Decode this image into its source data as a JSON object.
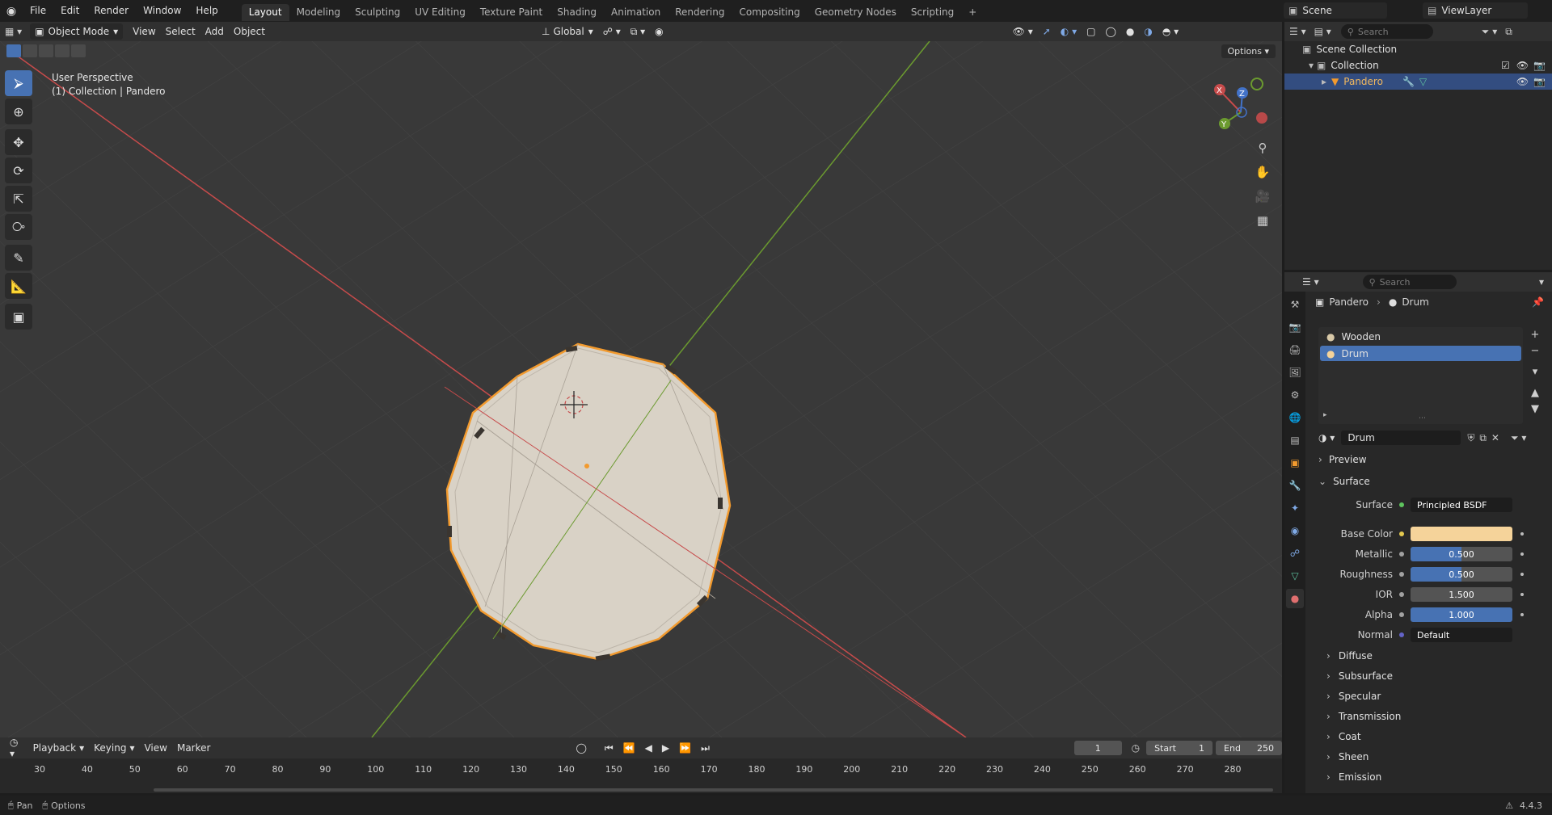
{
  "topbar": {
    "menu": [
      "File",
      "Edit",
      "Render",
      "Window",
      "Help"
    ],
    "workspaces": [
      "Layout",
      "Modeling",
      "Sculpting",
      "UV Editing",
      "Texture Paint",
      "Shading",
      "Animation",
      "Rendering",
      "Compositing",
      "Geometry Nodes",
      "Scripting"
    ],
    "active_workspace": "Layout",
    "add_tab": "+",
    "scene": "Scene",
    "view_layer": "ViewLayer"
  },
  "viewport_header": {
    "mode": "Object Mode",
    "menus": [
      "View",
      "Select",
      "Add",
      "Object"
    ],
    "orientation": "Global",
    "options": "Options"
  },
  "viewport": {
    "perspective_label": "User Perspective",
    "collection_label": "(1) Collection | Pandero",
    "gizmo": {
      "x": "X",
      "y": "Y",
      "z": "Z"
    },
    "colors": {
      "bg": "#393939",
      "x_axis": "#c74b4b",
      "y_axis": "#6b9a2f",
      "object": "#d9d2c6",
      "selection": "#f29a2e"
    }
  },
  "outliner": {
    "search_placeholder": "Search",
    "rows": [
      {
        "label": "Scene Collection"
      },
      {
        "label": "Collection"
      },
      {
        "label": "Pandero"
      }
    ]
  },
  "properties": {
    "search_placeholder": "Search",
    "breadcrumb": [
      "Pandero",
      "Drum"
    ],
    "materials": [
      "Wooden",
      "Drum"
    ],
    "material_name": "Drum",
    "panels": {
      "preview": "Preview",
      "surface": "Surface"
    },
    "surface_shader_label": "Surface",
    "surface_shader": "Principled BSDF",
    "fields": [
      {
        "label": "Base Color",
        "value": ""
      },
      {
        "label": "Metallic",
        "value": "0.500"
      },
      {
        "label": "Roughness",
        "value": "0.500"
      },
      {
        "label": "IOR",
        "value": "1.500"
      },
      {
        "label": "Alpha",
        "value": "1.000"
      },
      {
        "label": "Normal",
        "value": "Default"
      }
    ],
    "subpanels": [
      "Diffuse",
      "Subsurface",
      "Specular",
      "Transmission",
      "Coat",
      "Sheen",
      "Emission"
    ],
    "base_color": "#f5d39a"
  },
  "timeline": {
    "menus": [
      "Playback",
      "Keying",
      "View",
      "Marker"
    ],
    "current_frame": "1",
    "start_label": "Start",
    "start": "1",
    "end_label": "End",
    "end": "250",
    "ticks": [
      "30",
      "40",
      "50",
      "60",
      "70",
      "80",
      "90",
      "100",
      "110",
      "120",
      "130",
      "140",
      "150",
      "160",
      "170",
      "180",
      "190",
      "200",
      "210",
      "220",
      "230",
      "240",
      "250",
      "260",
      "270",
      "280"
    ]
  },
  "statusbar": {
    "pan": "Pan",
    "options": "Options",
    "version": "4.4.3"
  }
}
